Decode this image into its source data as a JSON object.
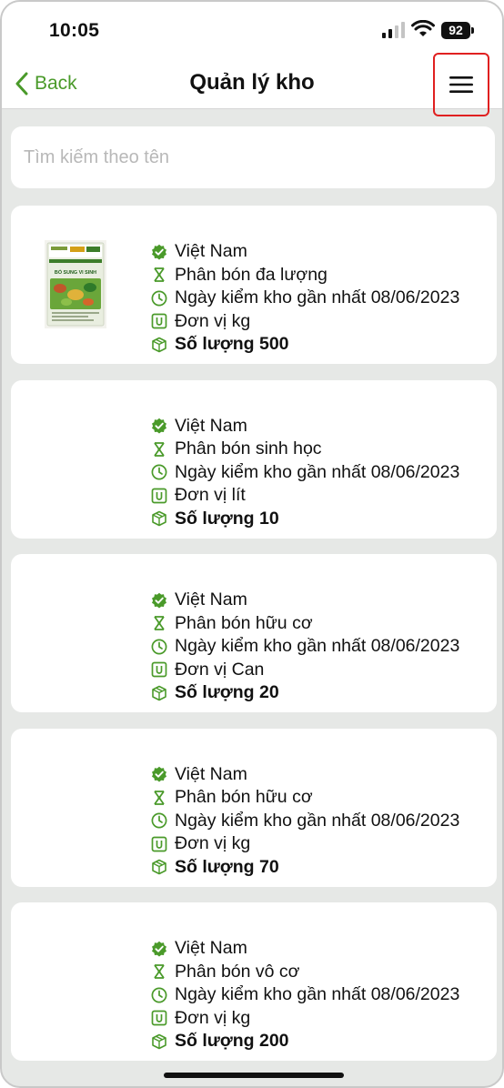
{
  "status": {
    "time": "10:05",
    "battery": "92"
  },
  "nav": {
    "back_label": "Back",
    "title": "Quản lý kho"
  },
  "search": {
    "placeholder": "Tìm kiếm theo tên",
    "value": ""
  },
  "accent_color": "#4a9a2a",
  "products": [
    {
      "has_image": true,
      "image_text": "BỔ SUNG VI SINH",
      "origin": "Việt Nam",
      "category": "Phân bón đa lượng",
      "check_date": "Ngày kiểm kho gần nhất 08/06/2023",
      "unit": "Đơn vị kg",
      "quantity": "Số lượng 500"
    },
    {
      "has_image": false,
      "origin": "Việt Nam",
      "category": "Phân bón sinh học",
      "check_date": "Ngày kiểm kho gần nhất 08/06/2023",
      "unit": "Đơn vị lít",
      "quantity": "Số lượng 10"
    },
    {
      "has_image": false,
      "origin": "Việt Nam",
      "category": "Phân bón hữu cơ",
      "check_date": "Ngày kiểm kho gần nhất 08/06/2023",
      "unit": "Đơn vị Can",
      "quantity": "Số lượng 20"
    },
    {
      "has_image": false,
      "origin": "Việt Nam",
      "category": "Phân bón hữu cơ",
      "check_date": "Ngày kiểm kho gần nhất 08/06/2023",
      "unit": "Đơn vị kg",
      "quantity": "Số lượng 70"
    },
    {
      "has_image": false,
      "origin": "Việt Nam",
      "category": "Phân bón vô cơ",
      "check_date": "Ngày kiểm kho gần nhất 08/06/2023",
      "unit": "Đơn vị kg",
      "quantity": "Số lượng 200"
    }
  ],
  "icons": {
    "origin": "verified-badge-icon",
    "category": "fertilizer-icon",
    "check_date": "clock-icon",
    "unit": "unit-icon",
    "quantity": "box-icon"
  }
}
